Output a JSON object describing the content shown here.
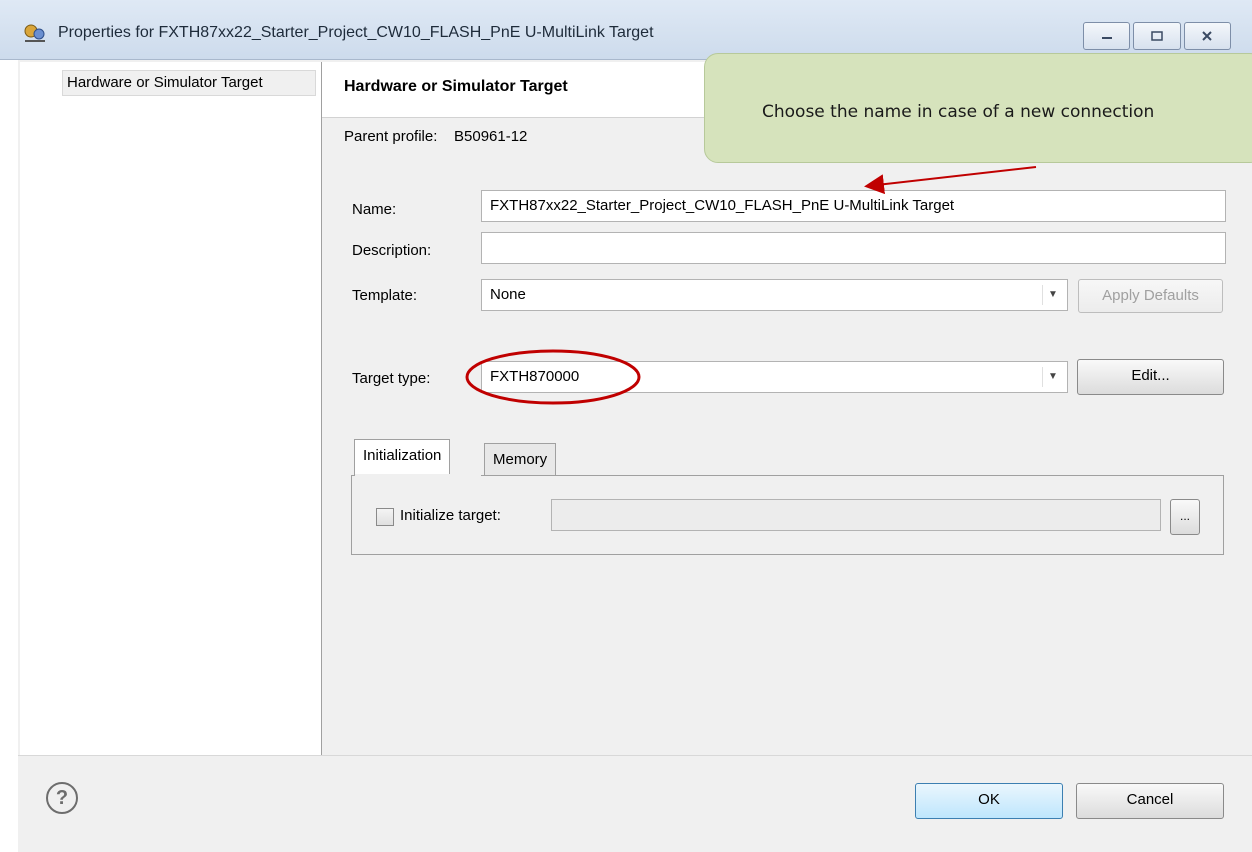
{
  "window": {
    "title": "Properties for FXTH87xx22_Starter_Project_CW10_FLASH_PnE U-MultiLink Target",
    "app_icon": "project-properties-icon",
    "controls": {
      "minimize": "minimize-icon",
      "maximize": "maximize-icon",
      "close": "close-icon"
    }
  },
  "sidebar": {
    "items": [
      {
        "label": "Hardware or Simulator Target"
      }
    ]
  },
  "page": {
    "title": "Hardware or Simulator Target",
    "parent_profile_label": "Parent profile:",
    "parent_profile_value": "B50961-12",
    "name_label": "Name:",
    "name_value": "FXTH87xx22_Starter_Project_CW10_FLASH_PnE U-MultiLink Target",
    "description_label": "Description:",
    "description_value": "",
    "template_label": "Template:",
    "template_value": "None",
    "apply_defaults_label": "Apply Defaults",
    "target_type_label": "Target type:",
    "target_type_value": "FXTH870000",
    "edit_label": "Edit...",
    "tabs": [
      {
        "label": "Initialization"
      },
      {
        "label": "Memory"
      }
    ],
    "initialize_target_label": "Initialize target:",
    "initialize_target_checked": false,
    "initialize_target_value": "",
    "browse_label": "..."
  },
  "footer": {
    "help_icon": "help-icon",
    "ok_label": "OK",
    "cancel_label": "Cancel"
  },
  "annotation": {
    "callout_text": "Choose the name in case of a new connection",
    "callout_color": "#d6e3bc",
    "highlight_color": "#c00000"
  }
}
